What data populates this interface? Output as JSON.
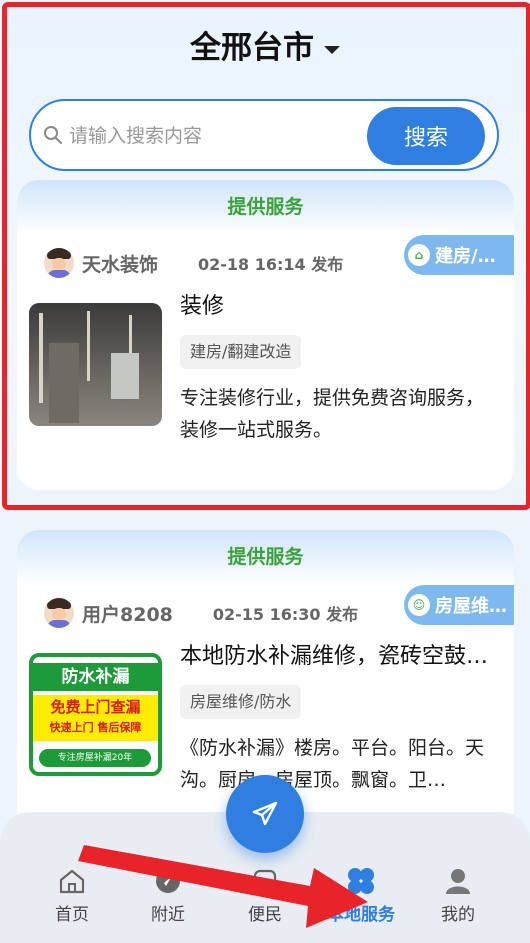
{
  "header": {
    "city": "全邢台市"
  },
  "search": {
    "placeholder": "请输入搜索内容",
    "button_label": "搜索"
  },
  "listings": [
    {
      "section_label": "提供服务",
      "user_name": "天水装饰",
      "post_time": "02-18 16:14 发布",
      "category_tag": "建房/…",
      "title": "装修",
      "subcategory": "建房/翻建改造",
      "description": "专注装修行业，提供免费咨询服务，装修一站式服务。"
    },
    {
      "section_label": "提供服务",
      "user_name": "用户8208",
      "post_time": "02-15 16:30 发布",
      "category_tag": "房屋维…",
      "title": "本地防水补漏维修，瓷砖空鼓…",
      "subcategory": "房屋维修/防水",
      "description": "《防水补漏》楼房。平台。阳台。天沟。厨房。房屋顶。飘窗。卫…",
      "image_text": {
        "line1": "防水补漏",
        "line2": "免费上门查漏",
        "line3": "快速上门 售后保障",
        "line4": "专注房屋补漏20年"
      }
    }
  ],
  "bottom_nav": {
    "items": [
      {
        "label": "首页",
        "icon": "home-icon"
      },
      {
        "label": "附近",
        "icon": "compass-icon"
      },
      {
        "label": "便民",
        "icon": "convenience-icon"
      },
      {
        "label": "本地服务",
        "icon": "clover-icon",
        "active": true
      },
      {
        "label": "我的",
        "icon": "user-icon"
      }
    ]
  },
  "colors": {
    "accent": "#2f7fe0",
    "section_green": "#3ba13b",
    "highlight_red": "#e8232a"
  }
}
